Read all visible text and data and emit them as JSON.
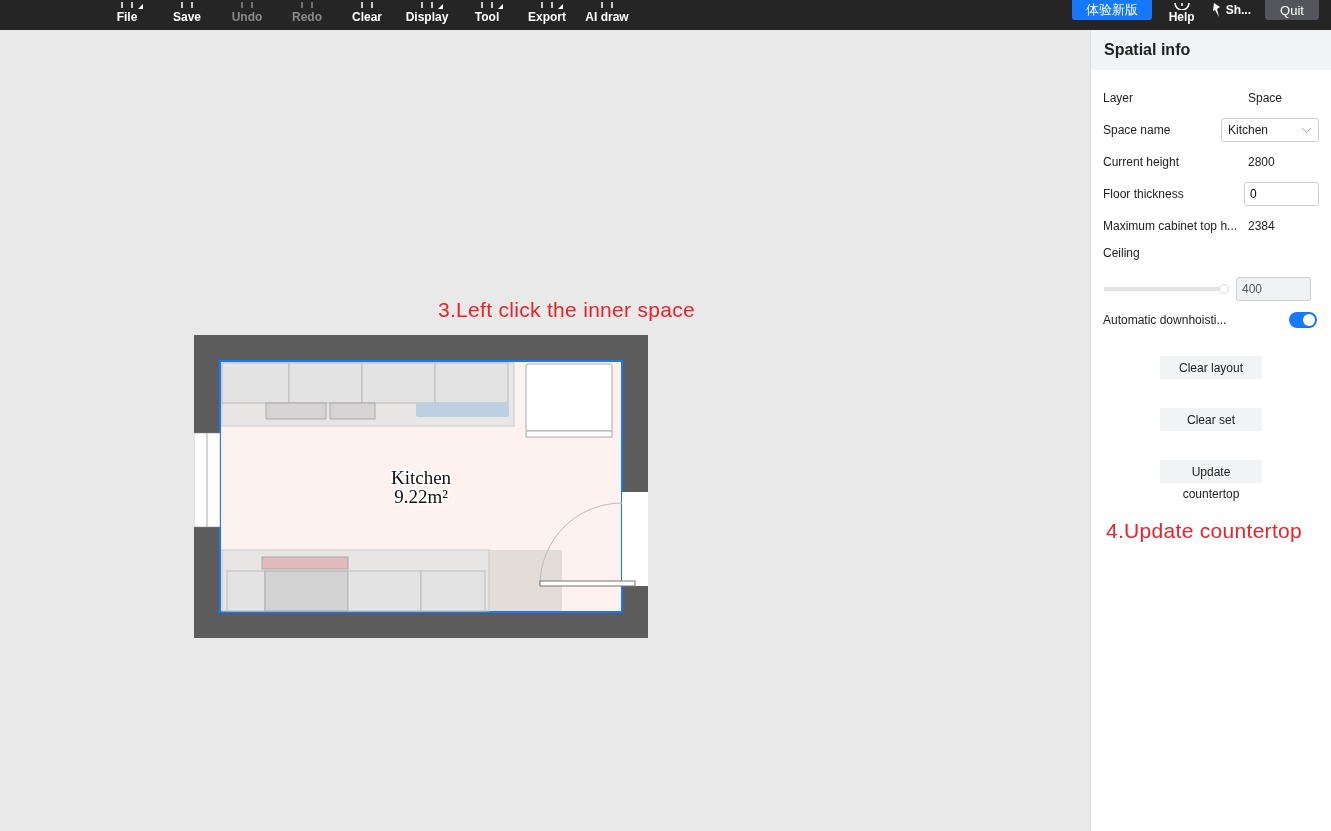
{
  "toolbar": {
    "items": [
      {
        "label": "File",
        "disabled": false,
        "dropdown": true
      },
      {
        "label": "Save",
        "disabled": false,
        "dropdown": false
      },
      {
        "label": "Undo",
        "disabled": true,
        "dropdown": false
      },
      {
        "label": "Redo",
        "disabled": true,
        "dropdown": false
      },
      {
        "label": "Clear",
        "disabled": false,
        "dropdown": false
      },
      {
        "label": "Display",
        "disabled": false,
        "dropdown": true
      },
      {
        "label": "Tool",
        "disabled": false,
        "dropdown": true
      },
      {
        "label": "Export",
        "disabled": false,
        "dropdown": true
      },
      {
        "label": "AI draw",
        "disabled": false,
        "dropdown": false
      }
    ],
    "new_version_button": "体验新版",
    "help": "Help",
    "share": "Sh...",
    "quit": "Quit"
  },
  "canvas": {
    "hint": "3.Left click the inner space",
    "room": {
      "name": "Kitchen",
      "area": "9.22m²",
      "selected": true
    }
  },
  "panel": {
    "title": "Spatial info",
    "fields": [
      {
        "kind": "text",
        "label": "Layer",
        "value": "Space"
      },
      {
        "kind": "select",
        "label": "Space name",
        "value": "Kitchen"
      },
      {
        "kind": "text",
        "label": "Current height",
        "value": "2800"
      },
      {
        "kind": "input",
        "label": "Floor thickness",
        "value": "0"
      },
      {
        "kind": "text",
        "label": "Maximum cabinet top h...",
        "value": "2384"
      },
      {
        "kind": "slider",
        "label": "Ceiling",
        "level": 1.0,
        "value": "400"
      },
      {
        "kind": "toggle",
        "label": "Automatic downhoisti...",
        "on": true
      }
    ],
    "buttons": [
      "Clear layout",
      "Clear set",
      "Update"
    ],
    "button_note": "countertop",
    "hint": "4.Update countertop"
  }
}
